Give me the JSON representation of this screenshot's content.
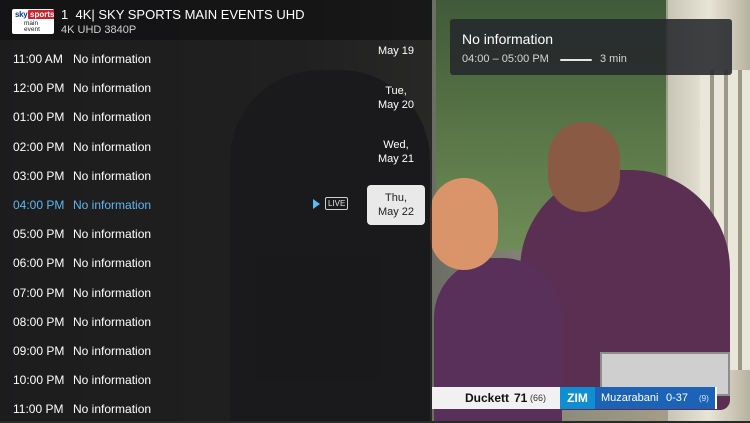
{
  "channel": {
    "number": "1",
    "name": "4K| SKY SPORTS MAIN EVENTS UHD",
    "quality": "4K UHD 3840P",
    "logo": {
      "line1": "sky",
      "line2": "sports",
      "line3": "main event"
    }
  },
  "schedule": [
    {
      "time": "11:00 AM",
      "program": "No information",
      "active": false
    },
    {
      "time": "12:00 PM",
      "program": "No information",
      "active": false
    },
    {
      "time": "01:00 PM",
      "program": "No information",
      "active": false
    },
    {
      "time": "02:00 PM",
      "program": "No information",
      "active": false
    },
    {
      "time": "03:00 PM",
      "program": "No information",
      "active": false
    },
    {
      "time": "04:00 PM",
      "program": "No information",
      "active": true
    },
    {
      "time": "05:00 PM",
      "program": "No information",
      "active": false
    },
    {
      "time": "06:00 PM",
      "program": "No information",
      "active": false
    },
    {
      "time": "07:00 PM",
      "program": "No information",
      "active": false
    },
    {
      "time": "08:00 PM",
      "program": "No information",
      "active": false
    },
    {
      "time": "09:00 PM",
      "program": "No information",
      "active": false
    },
    {
      "time": "10:00 PM",
      "program": "No information",
      "active": false
    },
    {
      "time": "11:00 PM",
      "program": "No information",
      "active": false
    }
  ],
  "live_label": "LIVE",
  "dates": [
    {
      "day": "",
      "date": "May 19",
      "selected": false
    },
    {
      "day": "Tue,",
      "date": "May 20",
      "selected": false
    },
    {
      "day": "Wed,",
      "date": "May 21",
      "selected": false
    },
    {
      "day": "Thu,",
      "date": "May 22",
      "selected": true
    }
  ],
  "info_popup": {
    "title": "No information",
    "time_range": "04:00 – 05:00 PM",
    "duration": "3 min",
    "progress": 0.05
  },
  "scorebug": {
    "batter": "Duckett",
    "runs": "71",
    "balls": "(66)",
    "team": "ZIM",
    "bowler": "Muzarabani",
    "figures": "0-37",
    "overs": "(9)"
  },
  "colors": {
    "accent": "#5eb6f2",
    "overlay": "#141416",
    "selected_date": "#e9e9e9",
    "scorebug_blue": "#1c63b8"
  },
  "icons": [
    "play-icon",
    "sky-sports-logo"
  ]
}
